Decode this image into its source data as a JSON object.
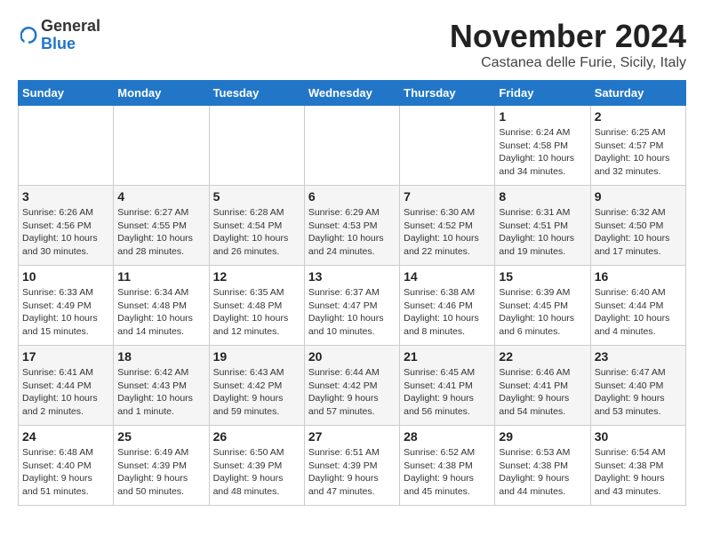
{
  "header": {
    "logo_general": "General",
    "logo_blue": "Blue",
    "month_title": "November 2024",
    "location": "Castanea delle Furie, Sicily, Italy"
  },
  "weekdays": [
    "Sunday",
    "Monday",
    "Tuesday",
    "Wednesday",
    "Thursday",
    "Friday",
    "Saturday"
  ],
  "weeks": [
    [
      {
        "day": "",
        "info": ""
      },
      {
        "day": "",
        "info": ""
      },
      {
        "day": "",
        "info": ""
      },
      {
        "day": "",
        "info": ""
      },
      {
        "day": "",
        "info": ""
      },
      {
        "day": "1",
        "info": "Sunrise: 6:24 AM\nSunset: 4:58 PM\nDaylight: 10 hours\nand 34 minutes."
      },
      {
        "day": "2",
        "info": "Sunrise: 6:25 AM\nSunset: 4:57 PM\nDaylight: 10 hours\nand 32 minutes."
      }
    ],
    [
      {
        "day": "3",
        "info": "Sunrise: 6:26 AM\nSunset: 4:56 PM\nDaylight: 10 hours\nand 30 minutes."
      },
      {
        "day": "4",
        "info": "Sunrise: 6:27 AM\nSunset: 4:55 PM\nDaylight: 10 hours\nand 28 minutes."
      },
      {
        "day": "5",
        "info": "Sunrise: 6:28 AM\nSunset: 4:54 PM\nDaylight: 10 hours\nand 26 minutes."
      },
      {
        "day": "6",
        "info": "Sunrise: 6:29 AM\nSunset: 4:53 PM\nDaylight: 10 hours\nand 24 minutes."
      },
      {
        "day": "7",
        "info": "Sunrise: 6:30 AM\nSunset: 4:52 PM\nDaylight: 10 hours\nand 22 minutes."
      },
      {
        "day": "8",
        "info": "Sunrise: 6:31 AM\nSunset: 4:51 PM\nDaylight: 10 hours\nand 19 minutes."
      },
      {
        "day": "9",
        "info": "Sunrise: 6:32 AM\nSunset: 4:50 PM\nDaylight: 10 hours\nand 17 minutes."
      }
    ],
    [
      {
        "day": "10",
        "info": "Sunrise: 6:33 AM\nSunset: 4:49 PM\nDaylight: 10 hours\nand 15 minutes."
      },
      {
        "day": "11",
        "info": "Sunrise: 6:34 AM\nSunset: 4:48 PM\nDaylight: 10 hours\nand 14 minutes."
      },
      {
        "day": "12",
        "info": "Sunrise: 6:35 AM\nSunset: 4:48 PM\nDaylight: 10 hours\nand 12 minutes."
      },
      {
        "day": "13",
        "info": "Sunrise: 6:37 AM\nSunset: 4:47 PM\nDaylight: 10 hours\nand 10 minutes."
      },
      {
        "day": "14",
        "info": "Sunrise: 6:38 AM\nSunset: 4:46 PM\nDaylight: 10 hours\nand 8 minutes."
      },
      {
        "day": "15",
        "info": "Sunrise: 6:39 AM\nSunset: 4:45 PM\nDaylight: 10 hours\nand 6 minutes."
      },
      {
        "day": "16",
        "info": "Sunrise: 6:40 AM\nSunset: 4:44 PM\nDaylight: 10 hours\nand 4 minutes."
      }
    ],
    [
      {
        "day": "17",
        "info": "Sunrise: 6:41 AM\nSunset: 4:44 PM\nDaylight: 10 hours\nand 2 minutes."
      },
      {
        "day": "18",
        "info": "Sunrise: 6:42 AM\nSunset: 4:43 PM\nDaylight: 10 hours\nand 1 minute."
      },
      {
        "day": "19",
        "info": "Sunrise: 6:43 AM\nSunset: 4:42 PM\nDaylight: 9 hours\nand 59 minutes."
      },
      {
        "day": "20",
        "info": "Sunrise: 6:44 AM\nSunset: 4:42 PM\nDaylight: 9 hours\nand 57 minutes."
      },
      {
        "day": "21",
        "info": "Sunrise: 6:45 AM\nSunset: 4:41 PM\nDaylight: 9 hours\nand 56 minutes."
      },
      {
        "day": "22",
        "info": "Sunrise: 6:46 AM\nSunset: 4:41 PM\nDaylight: 9 hours\nand 54 minutes."
      },
      {
        "day": "23",
        "info": "Sunrise: 6:47 AM\nSunset: 4:40 PM\nDaylight: 9 hours\nand 53 minutes."
      }
    ],
    [
      {
        "day": "24",
        "info": "Sunrise: 6:48 AM\nSunset: 4:40 PM\nDaylight: 9 hours\nand 51 minutes."
      },
      {
        "day": "25",
        "info": "Sunrise: 6:49 AM\nSunset: 4:39 PM\nDaylight: 9 hours\nand 50 minutes."
      },
      {
        "day": "26",
        "info": "Sunrise: 6:50 AM\nSunset: 4:39 PM\nDaylight: 9 hours\nand 48 minutes."
      },
      {
        "day": "27",
        "info": "Sunrise: 6:51 AM\nSunset: 4:39 PM\nDaylight: 9 hours\nand 47 minutes."
      },
      {
        "day": "28",
        "info": "Sunrise: 6:52 AM\nSunset: 4:38 PM\nDaylight: 9 hours\nand 45 minutes."
      },
      {
        "day": "29",
        "info": "Sunrise: 6:53 AM\nSunset: 4:38 PM\nDaylight: 9 hours\nand 44 minutes."
      },
      {
        "day": "30",
        "info": "Sunrise: 6:54 AM\nSunset: 4:38 PM\nDaylight: 9 hours\nand 43 minutes."
      }
    ]
  ]
}
